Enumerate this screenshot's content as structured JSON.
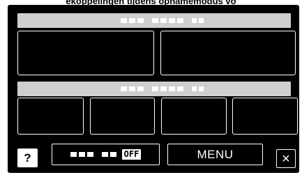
{
  "caption": "ekoppelingen tijdens opnamemodus vo",
  "header1": {
    "label_hint": "redacted header label"
  },
  "header2": {
    "label_hint": "redacted header label"
  },
  "help": {
    "label": "?"
  },
  "off_toggle": {
    "state": "OFF"
  },
  "menu": {
    "label": "MENU"
  },
  "close": {
    "icon": "×"
  }
}
